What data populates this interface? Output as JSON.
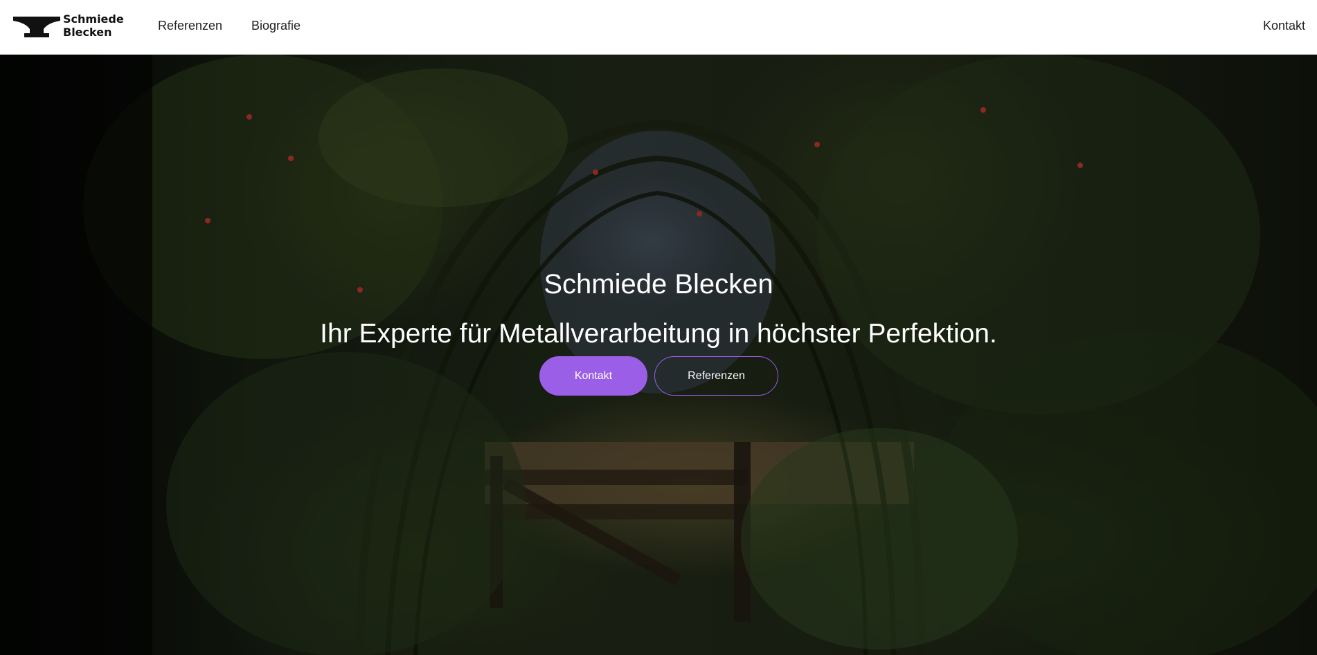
{
  "header": {
    "brand": {
      "line1": "Schmiede",
      "line2": "Blecken",
      "logo_icon": "anvil-icon"
    },
    "nav": [
      {
        "label": "Referenzen"
      },
      {
        "label": "Biografie"
      }
    ],
    "contact_label": "Kontakt"
  },
  "hero": {
    "title": "Schmiede Blecken",
    "subtitle": "Ihr Experte für Metallverarbeitung in höchster Perfektion.",
    "primary_button": "Kontakt",
    "secondary_button": "Referenzen"
  },
  "colors": {
    "accent": "#9b5ee6",
    "header_bg": "#ffffff",
    "text_dark": "#222222"
  }
}
